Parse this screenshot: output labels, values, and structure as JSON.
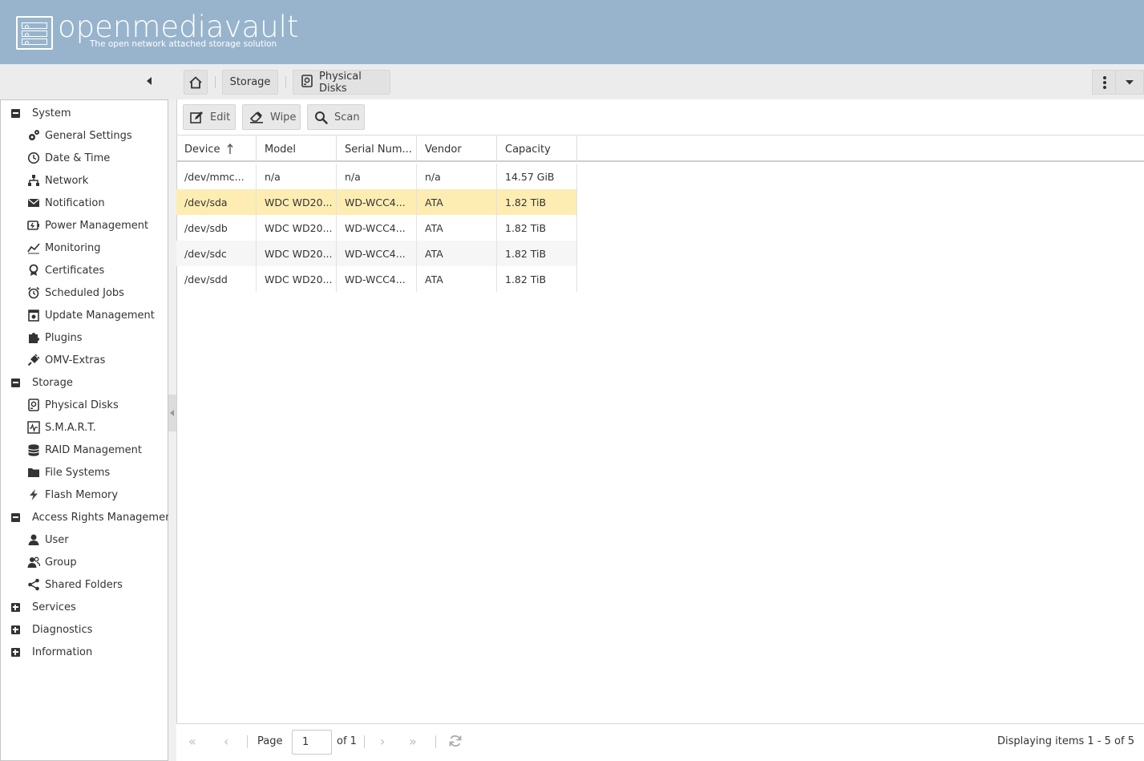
{
  "app": {
    "name": "openmediavault",
    "tagline": "The open network attached storage solution"
  },
  "breadcrumb": {
    "storage": "Storage",
    "current": "Physical Disks"
  },
  "sidebar": {
    "groups": [
      {
        "label": "System",
        "expanded": true,
        "items": [
          {
            "label": "General Settings",
            "icon": "gears-icon"
          },
          {
            "label": "Date & Time",
            "icon": "clock-icon"
          },
          {
            "label": "Network",
            "icon": "network-icon"
          },
          {
            "label": "Notification",
            "icon": "envelope-icon"
          },
          {
            "label": "Power Management",
            "icon": "power-icon"
          },
          {
            "label": "Monitoring",
            "icon": "chart-line-icon"
          },
          {
            "label": "Certificates",
            "icon": "certificate-icon"
          },
          {
            "label": "Scheduled Jobs",
            "icon": "alarm-clock-icon"
          },
          {
            "label": "Update Management",
            "icon": "update-icon"
          },
          {
            "label": "Plugins",
            "icon": "puzzle-icon"
          },
          {
            "label": "OMV-Extras",
            "icon": "plug-icon"
          }
        ]
      },
      {
        "label": "Storage",
        "expanded": true,
        "items": [
          {
            "label": "Physical Disks",
            "icon": "disk-icon"
          },
          {
            "label": "S.M.A.R.T.",
            "icon": "smart-icon"
          },
          {
            "label": "RAID Management",
            "icon": "database-icon"
          },
          {
            "label": "File Systems",
            "icon": "folder-icon"
          },
          {
            "label": "Flash Memory",
            "icon": "flash-icon"
          }
        ]
      },
      {
        "label": "Access Rights Management",
        "expanded": true,
        "items": [
          {
            "label": "User",
            "icon": "user-icon"
          },
          {
            "label": "Group",
            "icon": "group-icon"
          },
          {
            "label": "Shared Folders",
            "icon": "share-icon"
          }
        ]
      },
      {
        "label": "Services",
        "expanded": false,
        "items": []
      },
      {
        "label": "Diagnostics",
        "expanded": false,
        "items": []
      },
      {
        "label": "Information",
        "expanded": false,
        "items": []
      }
    ]
  },
  "toolbar": {
    "edit": "Edit",
    "wipe": "Wipe",
    "scan": "Scan"
  },
  "grid": {
    "columns": [
      "Device",
      "Model",
      "Serial Num...",
      "Vendor",
      "Capacity"
    ],
    "sort_column": "Device",
    "sort_direction": "ascending",
    "rows": [
      [
        "/dev/mmc...",
        "n/a",
        "n/a",
        "n/a",
        "14.57 GiB"
      ],
      [
        "/dev/sda",
        "WDC WD20...",
        "WD-WCC4...",
        "ATA",
        "1.82 TiB"
      ],
      [
        "/dev/sdb",
        "WDC WD20...",
        "WD-WCC4...",
        "ATA",
        "1.82 TiB"
      ],
      [
        "/dev/sdc",
        "WDC WD20...",
        "WD-WCC4...",
        "ATA",
        "1.82 TiB"
      ],
      [
        "/dev/sdd",
        "WDC WD20...",
        "WD-WCC4...",
        "ATA",
        "1.82 TiB"
      ]
    ],
    "selected_row": 1
  },
  "paging": {
    "page_label": "Page",
    "page_value": "1",
    "of_label": "of 1",
    "status": "Displaying items 1 - 5 of 5"
  },
  "colors": {
    "header_bg": "#98b4cd",
    "selected_row": "#fdedb2"
  }
}
